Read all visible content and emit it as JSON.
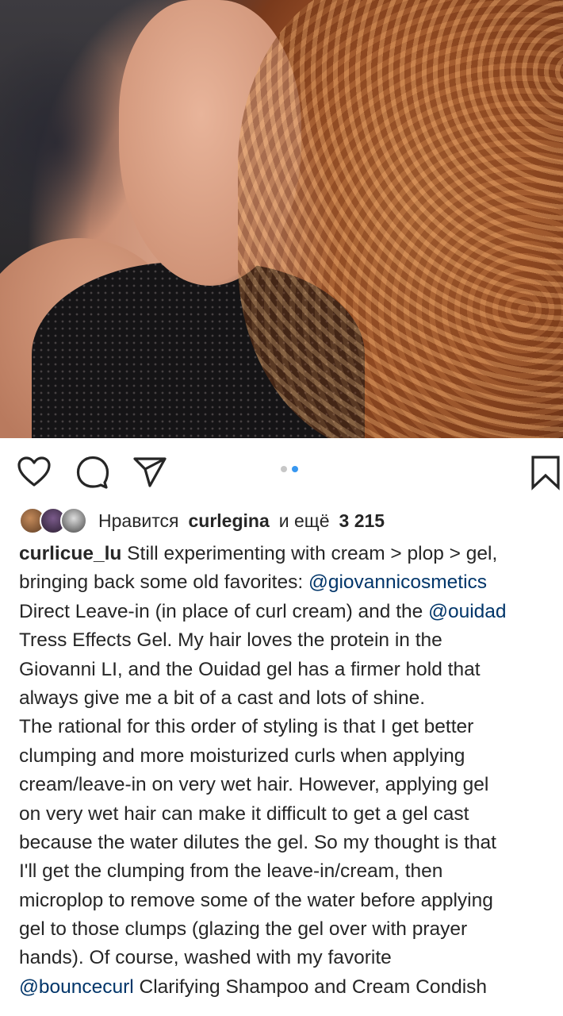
{
  "post": {
    "likes": {
      "prefix": "Нравится",
      "user": "curlegina",
      "mid": "и ещё",
      "count": "3 215"
    },
    "caption": {
      "username": "curlicue_lu",
      "lines": [
        [
          {
            "t": "Still experimenting with cream > plop > gel,"
          }
        ],
        [
          {
            "t": "bringing back some old favorites: "
          },
          {
            "t": "@giovannicosmetics",
            "m": true
          }
        ],
        [
          {
            "t": "Direct Leave-in (in place of curl cream) and the "
          },
          {
            "t": "@ouidad",
            "m": true
          }
        ],
        [
          {
            "t": "Tress Effects Gel.  My hair loves the protein in the"
          }
        ],
        [
          {
            "t": "Giovanni LI, and the Ouidad gel has a firmer hold that"
          }
        ],
        [
          {
            "t": "always give me a bit of a cast and lots of shine."
          }
        ],
        [
          {
            "t": "The rational for this order of styling is that I get better"
          }
        ],
        [
          {
            "t": "clumping and more moisturized curls when applying"
          }
        ],
        [
          {
            "t": "cream/leave-in on very wet hair.  However, applying gel"
          }
        ],
        [
          {
            "t": "on very wet hair can make it difficult to get a gel cast"
          }
        ],
        [
          {
            "t": "because the water dilutes the gel.  So my thought is that"
          }
        ],
        [
          {
            "t": "I'll get the clumping  from the leave-in/cream, then"
          }
        ],
        [
          {
            "t": "microplop to remove some of the water before applying"
          }
        ],
        [
          {
            "t": "gel to those clumps (glazing the gel over with prayer"
          }
        ],
        [
          {
            "t": "hands). Of course, washed with my favorite"
          }
        ],
        [
          {
            "t": "@bouncecurl",
            "m": true
          },
          {
            "t": " Clarifying Shampoo and Cream Condish"
          }
        ]
      ]
    },
    "carousel": {
      "total": 2,
      "active_index": 1
    },
    "icons": {
      "like": "heart-icon",
      "comment": "comment-icon",
      "share": "send-icon",
      "save": "bookmark-icon"
    },
    "colors": {
      "mention": "#003569",
      "active_dot": "#3897f0",
      "text": "#262626"
    }
  }
}
